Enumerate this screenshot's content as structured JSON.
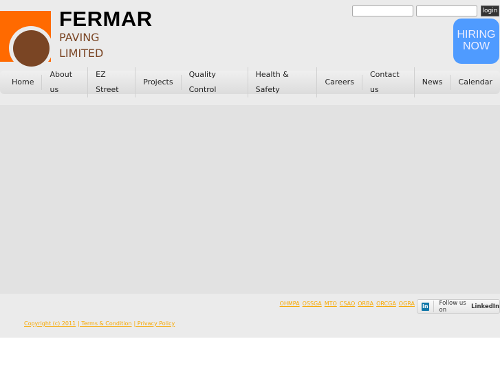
{
  "logo": {
    "brand": "FERMAR",
    "line1": "PAVING",
    "line2": "LIMITED"
  },
  "login": {
    "button": "login",
    "username_value": "",
    "password_value": ""
  },
  "hiring": {
    "line1": "HIRING",
    "line2": "NOW"
  },
  "nav": [
    "Home",
    "About us",
    "EZ Street",
    "Projects",
    "Quality Control",
    "Health & Safety",
    "Careers",
    "Contact us",
    "News",
    "Calendar"
  ],
  "footer": {
    "orgs": [
      "OHMPA",
      "OSSGA",
      "MTO",
      "CSAO",
      "ORBA",
      "ORCGA",
      "OGRA"
    ],
    "linkedin": {
      "icon": "in",
      "text": "Follow us on ",
      "bold": "LinkedIn"
    },
    "copyright": "Copyright (c) 2011",
    "terms": "| Terms & Condition",
    "privacy": "| Privacy Policy"
  },
  "colors": {
    "orange": "#ff6a00",
    "brown": "#7a4524",
    "hiring": "#4f9bff",
    "link": "#f7a800"
  }
}
